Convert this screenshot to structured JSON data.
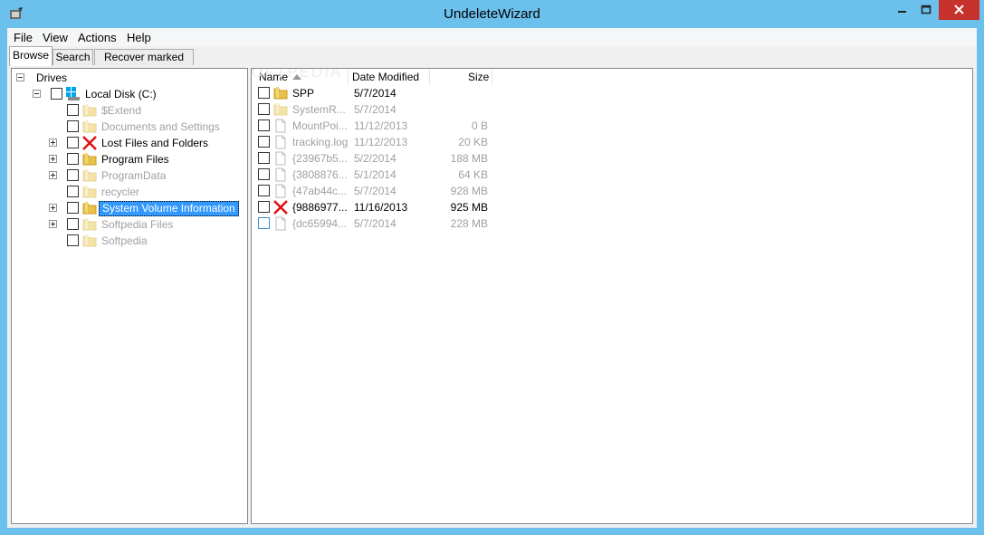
{
  "window": {
    "title": "UndeleteWizard",
    "icon": "app-icon"
  },
  "menu": [
    "File",
    "View",
    "Actions",
    "Help"
  ],
  "tabs": [
    "Browse",
    "Search",
    "Recover marked files"
  ],
  "tree": {
    "root_label": "Drives",
    "disk_label": "Local Disk (C:)",
    "items": [
      {
        "label": "$Extend",
        "dim": true,
        "expandable": false,
        "icon": "folder-icon"
      },
      {
        "label": "Documents and Settings",
        "dim": true,
        "expandable": false,
        "icon": "folder-icon"
      },
      {
        "label": "Lost Files and Folders",
        "dim": false,
        "expandable": true,
        "icon": "red-x-icon"
      },
      {
        "label": "Program Files",
        "dim": false,
        "expandable": true,
        "icon": "folder-icon"
      },
      {
        "label": "ProgramData",
        "dim": true,
        "expandable": true,
        "icon": "folder-icon"
      },
      {
        "label": "recycler",
        "dim": true,
        "expandable": false,
        "icon": "folder-icon"
      },
      {
        "label": "System Volume Information",
        "dim": false,
        "expandable": true,
        "icon": "folder-icon",
        "selected": true
      },
      {
        "label": "Softpedia Files",
        "dim": true,
        "expandable": true,
        "icon": "folder-icon"
      },
      {
        "label": "Softpedia",
        "dim": true,
        "expandable": false,
        "icon": "folder-icon"
      }
    ]
  },
  "list": {
    "columns": [
      "Name",
      "Date Modified",
      "Size"
    ],
    "rows": [
      {
        "name": "SPP",
        "date": "5/7/2014",
        "size": "",
        "dim": false,
        "icon": "folder-icon"
      },
      {
        "name": "SystemR...",
        "date": "5/7/2014",
        "size": "",
        "dim": true,
        "icon": "folder-icon"
      },
      {
        "name": "MountPoi...",
        "date": "11/12/2013",
        "size": "0 B",
        "dim": true,
        "icon": "file-icon"
      },
      {
        "name": "tracking.log",
        "date": "11/12/2013",
        "size": "20 KB",
        "dim": true,
        "icon": "file-icon"
      },
      {
        "name": "{23967b5...",
        "date": "5/2/2014",
        "size": "188 MB",
        "dim": true,
        "icon": "file-icon"
      },
      {
        "name": "{3808876...",
        "date": "5/1/2014",
        "size": "64 KB",
        "dim": true,
        "icon": "file-icon"
      },
      {
        "name": "{47ab44c...",
        "date": "5/7/2014",
        "size": "928 MB",
        "dim": true,
        "icon": "file-icon"
      },
      {
        "name": "{9886977...",
        "date": "11/16/2013",
        "size": "925 MB",
        "dim": false,
        "icon": "red-x-icon"
      },
      {
        "name": "{dc65994...",
        "date": "5/7/2014",
        "size": "228 MB",
        "dim": true,
        "icon": "file-icon",
        "blue_cb": true
      }
    ]
  },
  "watermark": "SOFTPEDIA"
}
